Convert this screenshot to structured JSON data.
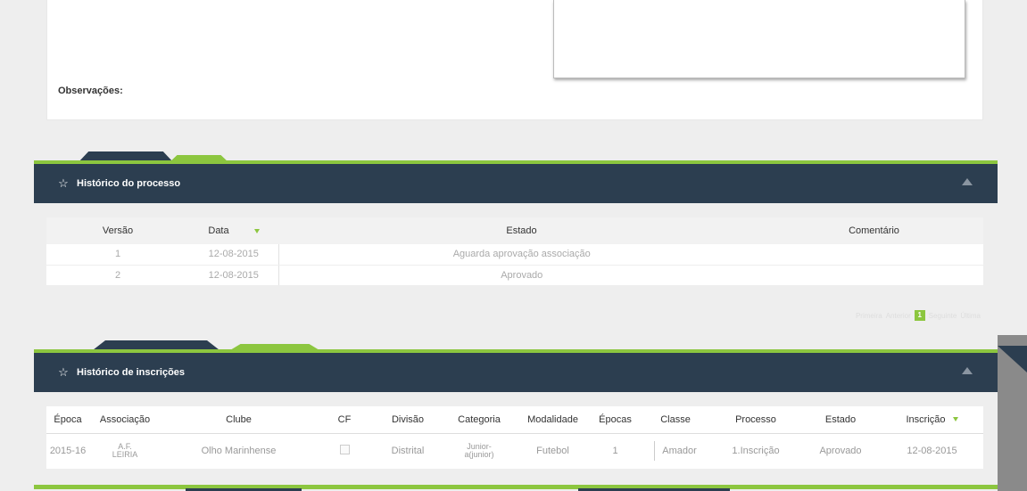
{
  "observacoes_label": "Observações:",
  "processo": {
    "title": "Histórico do processo",
    "columns": [
      "Versão",
      "Data",
      "Estado",
      "Comentário"
    ],
    "rows": [
      {
        "versao": "1",
        "data": "12-08-2015",
        "estado": "Aguarda aprovação associação",
        "comentario": ""
      },
      {
        "versao": "2",
        "data": "12-08-2015",
        "estado": "Aprovado",
        "comentario": ""
      }
    ],
    "pager": {
      "first": "Primeira",
      "prev": "Anterior",
      "current": "1",
      "next": "Seguinte",
      "last": "Última"
    }
  },
  "inscricoes": {
    "title": "Histórico de inscrições",
    "columns": [
      "Época",
      "Associação",
      "Clube",
      "CF",
      "Divisão",
      "Categoria",
      "Modalidade",
      "Épocas",
      "Classe",
      "Processo",
      "Estado",
      "Inscrição"
    ],
    "row": {
      "epoca": "2015-16",
      "associacao_1": "A.F.",
      "associacao_2": "LEIRIA",
      "clube": "Olho Marinhense",
      "divisao": "Distrital",
      "categoria_1": "Junior-",
      "categoria_2": "a(junior)",
      "modalidade": "Futebol",
      "epocas": "1",
      "classe": "Amador",
      "processo": "1.Inscrição",
      "estado": "Aprovado",
      "inscricao": "12-08-2015"
    }
  },
  "colors": {
    "accent": "#8cc63f",
    "header": "#2c3e50"
  },
  "icons": {
    "star": "star-icon",
    "toggle": "collapse-icon",
    "sort": "sort-down-icon"
  }
}
